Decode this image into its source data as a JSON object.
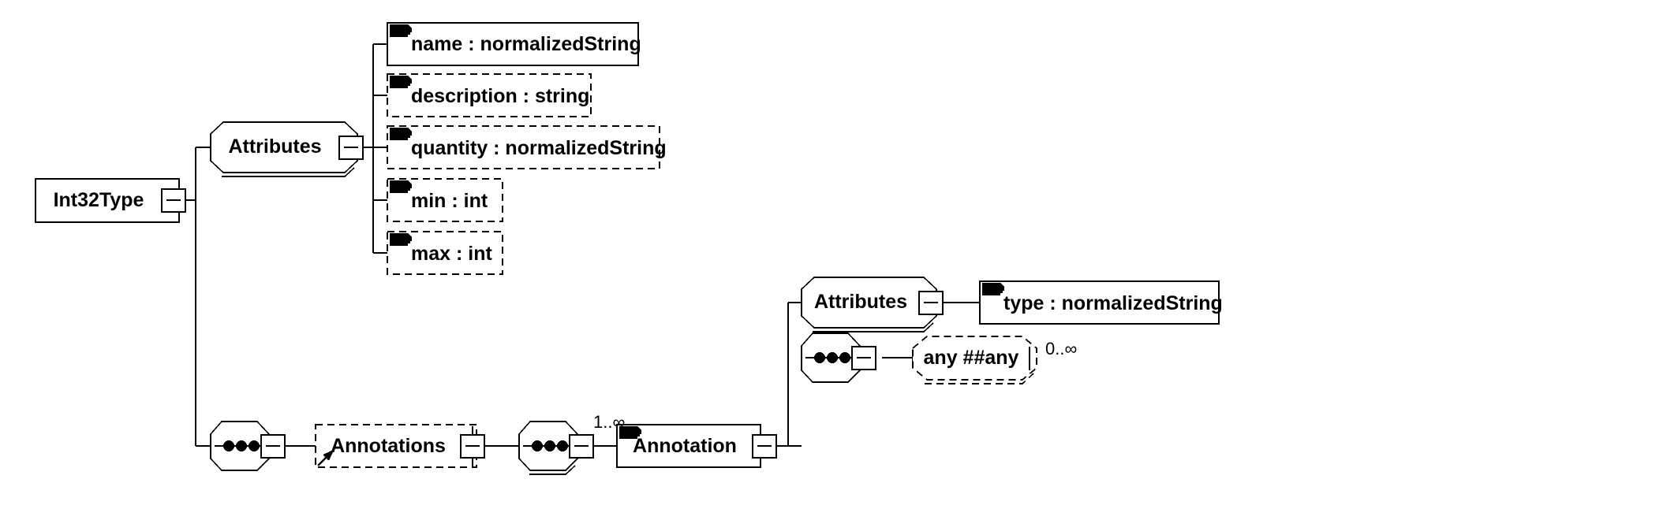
{
  "diagram": {
    "kind": "xsd-schema-diagram",
    "root_type": "Int32Type",
    "background_color": "#ffffff",
    "line_color": "#000000",
    "text_color": "#000000"
  },
  "nodes": {
    "root": {
      "label": "Int32Type",
      "shape": "rectangle",
      "border": "solid",
      "collapse_control": "minus"
    },
    "attributes_group_1": {
      "label": "Attributes",
      "shape": "octagon-double-bottom",
      "border": "solid",
      "collapse_control": "minus"
    },
    "attributes_group_2": {
      "label": "Attributes",
      "shape": "octagon-double-bottom",
      "border": "solid",
      "collapse_control": "minus"
    },
    "sequence_1": {
      "label": "sequence",
      "shape": "octagon",
      "border": "solid",
      "glyph": "three-dots",
      "collapse_control": "minus"
    },
    "sequence_2": {
      "label": "sequence",
      "shape": "octagon-double-bottom",
      "border": "solid",
      "glyph": "three-dots",
      "collapse_control": "minus"
    },
    "sequence_3": {
      "label": "sequence",
      "shape": "octagon",
      "border": "solid",
      "glyph": "three-dots",
      "collapse_control": "minus"
    },
    "annotations_ref": {
      "label": "Annotations",
      "shape": "rectangle",
      "border": "dashed",
      "reference_arrow": true,
      "collapse_control": "minus"
    },
    "annotation_element": {
      "label": "Annotation",
      "shape": "rectangle",
      "border": "solid",
      "marker": "element-marker",
      "occurs": "1..∞",
      "collapse_control": "minus"
    },
    "any_wildcard": {
      "label": "any  ##any",
      "shape": "octagon",
      "border": "dashed",
      "occurs": "0..∞"
    }
  },
  "attributes_of_root": [
    {
      "label": "name : normalizedString",
      "border": "solid",
      "marker": "attribute-marker",
      "use": "required"
    },
    {
      "label": "description : string",
      "border": "dashed",
      "marker": "attribute-marker",
      "use": "optional"
    },
    {
      "label": "quantity : normalizedString",
      "border": "dashed",
      "marker": "attribute-marker",
      "use": "optional"
    },
    {
      "label": "min : int",
      "border": "dashed",
      "marker": "attribute-marker",
      "use": "optional"
    },
    {
      "label": "max : int",
      "border": "dashed",
      "marker": "attribute-marker",
      "use": "optional"
    }
  ],
  "attributes_of_annotation": [
    {
      "label": "type : normalizedString",
      "border": "solid",
      "marker": "attribute-marker",
      "use": "required"
    }
  ],
  "occurrence_labels": {
    "annotation": "1..∞",
    "any": "0..∞"
  }
}
